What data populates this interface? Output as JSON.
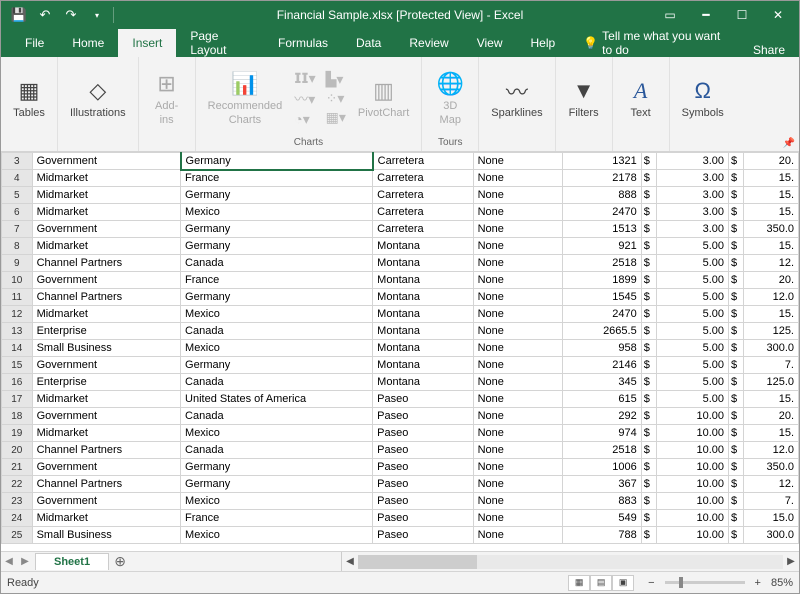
{
  "titlebar": {
    "title": "Financial Sample.xlsx  [Protected View]  -  Excel"
  },
  "tabs": [
    "File",
    "Home",
    "Insert",
    "Page Layout",
    "Formulas",
    "Data",
    "Review",
    "View",
    "Help"
  ],
  "tellme": "Tell me what you want to do",
  "share": "Share",
  "ribbon": {
    "tables": "Tables",
    "illustrations": "Illustrations",
    "addins": "Add-\nins",
    "recommended": "Recommended\nCharts",
    "pivotchart": "PivotChart",
    "map3d": "3D\nMap",
    "sparklines": "Sparklines",
    "filters": "Filters",
    "text": "Text",
    "symbols": "Symbols",
    "group_charts": "Charts",
    "group_tours": "Tours"
  },
  "rows": [
    {
      "n": 3,
      "a": "Government",
      "b": "Germany",
      "c": "Carretera",
      "d": "None",
      "e": "1321",
      "g": "3.00",
      "i": "20."
    },
    {
      "n": 4,
      "a": "Midmarket",
      "b": "France",
      "c": "Carretera",
      "d": "None",
      "e": "2178",
      "g": "3.00",
      "i": "15."
    },
    {
      "n": 5,
      "a": "Midmarket",
      "b": "Germany",
      "c": "Carretera",
      "d": "None",
      "e": "888",
      "g": "3.00",
      "i": "15."
    },
    {
      "n": 6,
      "a": "Midmarket",
      "b": "Mexico",
      "c": "Carretera",
      "d": "None",
      "e": "2470",
      "g": "3.00",
      "i": "15."
    },
    {
      "n": 7,
      "a": "Government",
      "b": "Germany",
      "c": "Carretera",
      "d": "None",
      "e": "1513",
      "g": "3.00",
      "i": "350.0"
    },
    {
      "n": 8,
      "a": "Midmarket",
      "b": "Germany",
      "c": "Montana",
      "d": "None",
      "e": "921",
      "g": "5.00",
      "i": "15."
    },
    {
      "n": 9,
      "a": "Channel Partners",
      "b": "Canada",
      "c": "Montana",
      "d": "None",
      "e": "2518",
      "g": "5.00",
      "i": "12."
    },
    {
      "n": 10,
      "a": "Government",
      "b": "France",
      "c": "Montana",
      "d": "None",
      "e": "1899",
      "g": "5.00",
      "i": "20."
    },
    {
      "n": 11,
      "a": "Channel Partners",
      "b": "Germany",
      "c": "Montana",
      "d": "None",
      "e": "1545",
      "g": "5.00",
      "i": "12.0"
    },
    {
      "n": 12,
      "a": "Midmarket",
      "b": "Mexico",
      "c": "Montana",
      "d": "None",
      "e": "2470",
      "g": "5.00",
      "i": "15."
    },
    {
      "n": 13,
      "a": "Enterprise",
      "b": "Canada",
      "c": "Montana",
      "d": "None",
      "e": "2665.5",
      "g": "5.00",
      "i": "125."
    },
    {
      "n": 14,
      "a": "Small Business",
      "b": "Mexico",
      "c": "Montana",
      "d": "None",
      "e": "958",
      "g": "5.00",
      "i": "300.0"
    },
    {
      "n": 15,
      "a": "Government",
      "b": "Germany",
      "c": "Montana",
      "d": "None",
      "e": "2146",
      "g": "5.00",
      "i": "7."
    },
    {
      "n": 16,
      "a": "Enterprise",
      "b": "Canada",
      "c": "Montana",
      "d": "None",
      "e": "345",
      "g": "5.00",
      "i": "125.0"
    },
    {
      "n": 17,
      "a": "Midmarket",
      "b": "United States of America",
      "c": "Paseo",
      "d": "None",
      "e": "615",
      "g": "5.00",
      "i": "15."
    },
    {
      "n": 18,
      "a": "Government",
      "b": "Canada",
      "c": "Paseo",
      "d": "None",
      "e": "292",
      "g": "10.00",
      "i": "20."
    },
    {
      "n": 19,
      "a": "Midmarket",
      "b": "Mexico",
      "c": "Paseo",
      "d": "None",
      "e": "974",
      "g": "10.00",
      "i": "15."
    },
    {
      "n": 20,
      "a": "Channel Partners",
      "b": "Canada",
      "c": "Paseo",
      "d": "None",
      "e": "2518",
      "g": "10.00",
      "i": "12.0"
    },
    {
      "n": 21,
      "a": "Government",
      "b": "Germany",
      "c": "Paseo",
      "d": "None",
      "e": "1006",
      "g": "10.00",
      "i": "350.0"
    },
    {
      "n": 22,
      "a": "Channel Partners",
      "b": "Germany",
      "c": "Paseo",
      "d": "None",
      "e": "367",
      "g": "10.00",
      "i": "12."
    },
    {
      "n": 23,
      "a": "Government",
      "b": "Mexico",
      "c": "Paseo",
      "d": "None",
      "e": "883",
      "g": "10.00",
      "i": "7."
    },
    {
      "n": 24,
      "a": "Midmarket",
      "b": "France",
      "c": "Paseo",
      "d": "None",
      "e": "549",
      "g": "10.00",
      "i": "15.0"
    },
    {
      "n": 25,
      "a": "Small Business",
      "b": "Mexico",
      "c": "Paseo",
      "d": "None",
      "e": "788",
      "g": "10.00",
      "i": "300.0"
    }
  ],
  "dollar": "$",
  "sheetname": "Sheet1",
  "status": "Ready",
  "zoom": "85%"
}
